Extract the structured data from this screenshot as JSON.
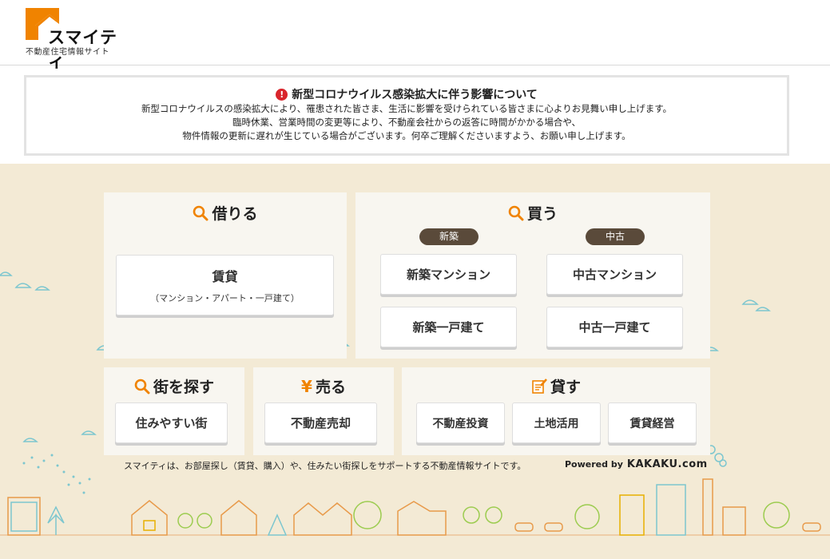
{
  "brand": {
    "name": "スマイティ",
    "tagline": "不動産住宅情報サイト"
  },
  "notice": {
    "title": "新型コロナウイルス感染拡大に伴う影響について",
    "lines": [
      "新型コロナウイルスの感染拡大により、罹患された皆さま、生活に影響を受けられている皆さまに心よりお見舞い申し上げます。",
      "臨時休業、営業時間の変更等により、不動産会社からの返答に時間がかかる場合や、",
      "物件情報の更新に遅れが生じている場合がございます。何卒ご理解くださいますよう、お願い申し上げます。"
    ]
  },
  "rent": {
    "title": "借りる",
    "chintai_label": "賃貸",
    "chintai_sub": "（マンション・アパート・一戸建て）"
  },
  "buy": {
    "title": "買う",
    "new_tag": "新築",
    "used_tag": "中古",
    "new_mansion": "新築マンション",
    "new_house": "新築一戸建て",
    "used_mansion": "中古マンション",
    "used_house": "中古一戸建て"
  },
  "town": {
    "title": "街を探す",
    "livable": "住みやすい街"
  },
  "sell": {
    "title": "売る",
    "yen_symbol": "¥",
    "real_estate_sale": "不動産売却"
  },
  "lend": {
    "title": "貸す",
    "investment": "不動産投資",
    "land_use": "土地活用",
    "rental_management": "賃貸経営"
  },
  "footer": {
    "description": "スマイティは、お部屋探し（賃貸、購入）や、住みたい街探しをサポートする不動産情報サイトです。",
    "powered_by": "Powered by",
    "kakaku": "KAKAKU.com"
  },
  "colors": {
    "accent_orange": "#f08300",
    "tag_brown": "#5a4a3a",
    "beige": "#f3ead5",
    "alert_red": "#d9252c"
  }
}
